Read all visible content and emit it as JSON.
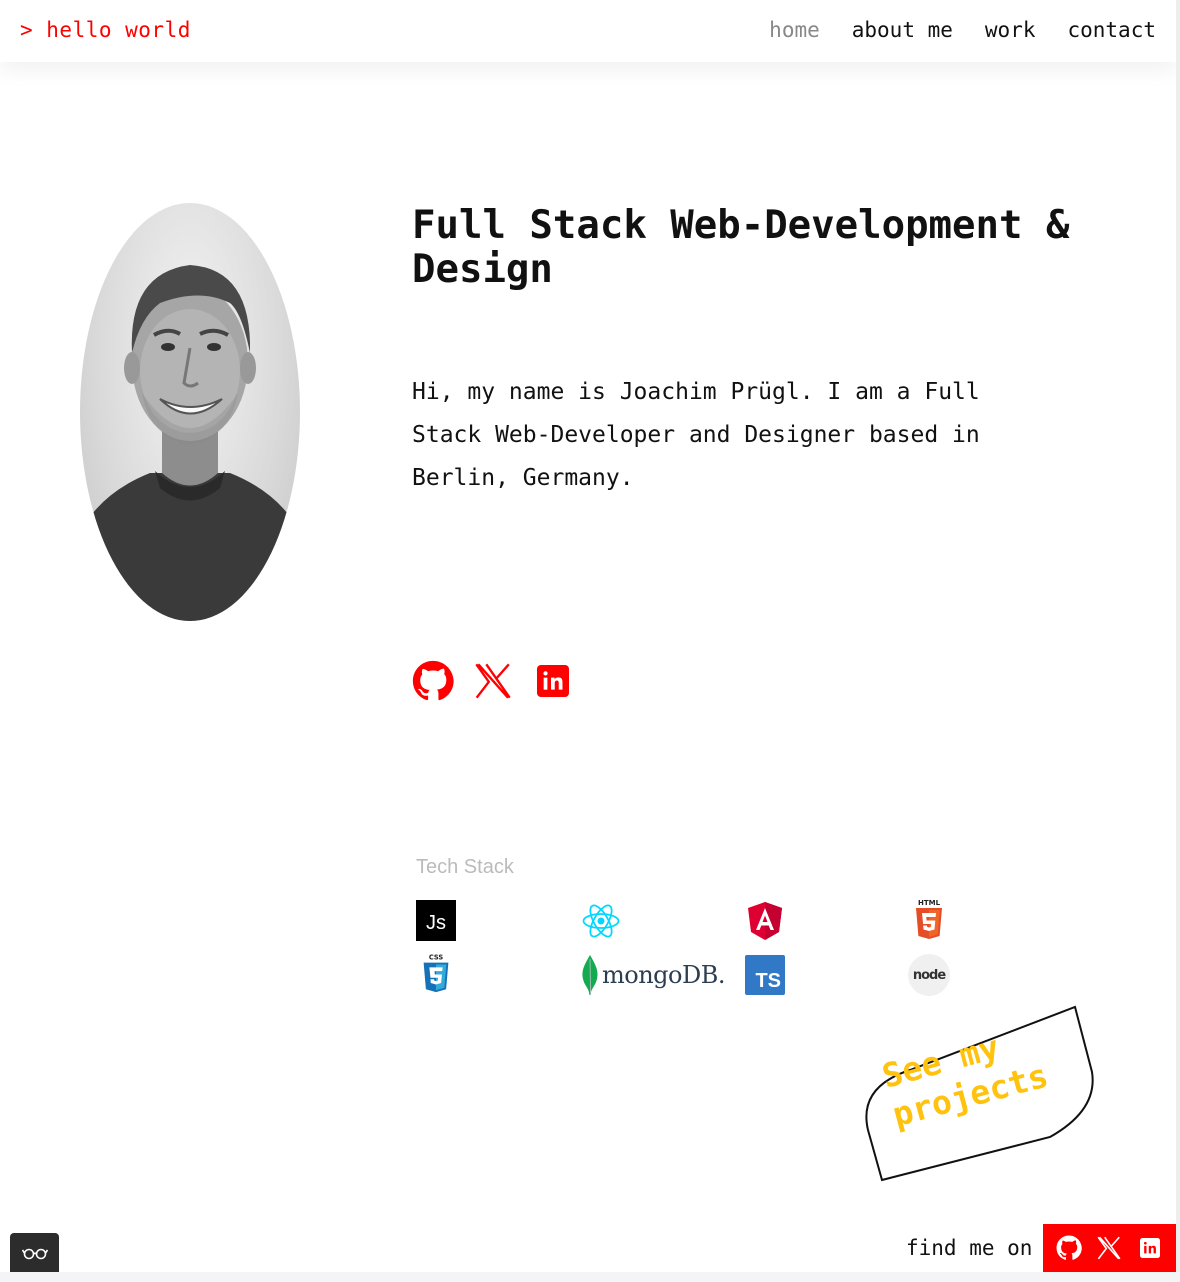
{
  "header": {
    "brand": "> hello world",
    "nav": [
      {
        "label": "home",
        "active": true
      },
      {
        "label": "about me",
        "active": false
      },
      {
        "label": "work",
        "active": false
      },
      {
        "label": "contact",
        "active": false
      }
    ]
  },
  "hero": {
    "title": "Full Stack Web-Development & Design",
    "intro": "Hi, my name is Joachim Prügl. I am a Full Stack Web-Developer and Designer based in Berlin, Germany.",
    "socials": [
      "github-icon",
      "x-icon",
      "linkedin-icon"
    ]
  },
  "tech_stack": {
    "title": "Tech Stack",
    "items": [
      "javascript-icon",
      "react-icon",
      "angular-icon",
      "html5-icon",
      "css3-icon",
      "mongodb-logo",
      "typescript-icon",
      "nodejs-icon"
    ],
    "js_label": "Js",
    "ts_label": "TS",
    "mongo_label": "mongoDB.",
    "html_label": "HTML",
    "css_label": "CSS",
    "node_label": "node"
  },
  "cta": {
    "label": "See my projects"
  },
  "footer": {
    "find_me": "find me on"
  },
  "colors": {
    "accent": "#ff0000",
    "sticker_text": "#ffc20e",
    "nav_active": "#888888",
    "tech_title": "#bbbbbb"
  }
}
